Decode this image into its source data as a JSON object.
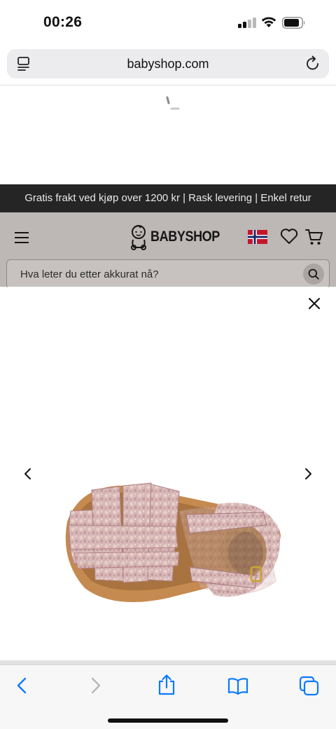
{
  "status_bar": {
    "time": "00:26"
  },
  "browser": {
    "url": "babyshop.com"
  },
  "site": {
    "promo_text": "Gratis frakt ved kjøp over 1200 kr | Rask levering | Enkel retur",
    "logo_text": "BABYSHOP",
    "search_placeholder": "Hva leter du etter akkurat nå?",
    "country_flag": "Norway"
  },
  "modal": {
    "product_image": "pink-glitter-baby-sandal"
  },
  "colors": {
    "promo_bg": "#252525",
    "dimmed_header": "#bdb7b5",
    "accent_blue": "#0a7aff"
  },
  "icons": {
    "reader": "reader-mode-icon",
    "reload": "reload-icon",
    "menu": "hamburger-menu-icon",
    "wishlist": "heart-icon",
    "cart": "cart-icon",
    "search": "search-icon",
    "close": "close-icon",
    "prev": "chevron-left-icon",
    "next": "chevron-right-icon",
    "back": "back-arrow-icon",
    "forward": "forward-arrow-icon",
    "share": "share-icon",
    "bookmarks": "bookmarks-icon",
    "tabs": "tabs-icon"
  }
}
